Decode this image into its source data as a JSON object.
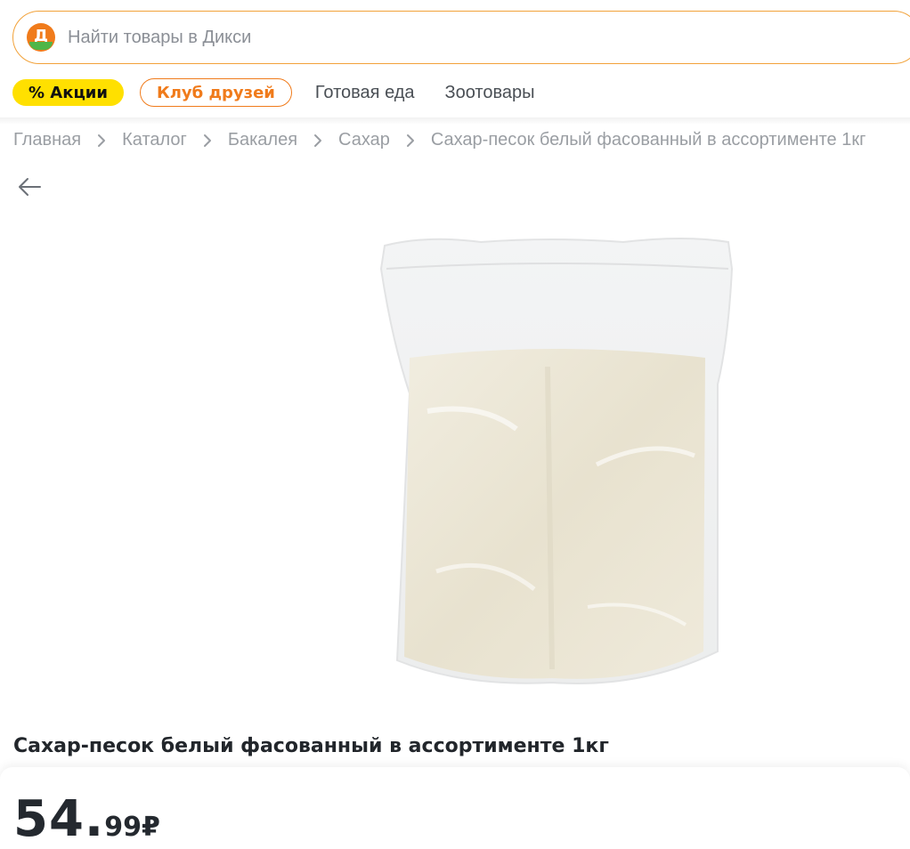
{
  "search": {
    "placeholder": "Найти товары в Дикси",
    "logo_letter": "Д"
  },
  "nav": {
    "sale_label": "% Акции",
    "club_label": "Клуб друзей",
    "links": [
      "Готовая еда",
      "Зоотовары"
    ]
  },
  "breadcrumb": [
    "Главная",
    "Каталог",
    "Бакалея",
    "Сахар",
    "Сахар-песок белый фасованный в ассортименте 1кг"
  ],
  "product": {
    "title": "Сахар-песок белый фасованный в ассортименте 1кг",
    "price_int": "54.",
    "price_frac": "99",
    "currency": "₽"
  },
  "colors": {
    "accent_orange": "#f07b1b",
    "sale_yellow": "#ffe000",
    "logo_green": "#4fb648"
  },
  "icons": {
    "logo": "dixy-logo-icon",
    "back": "arrow-left-icon",
    "separator": "chevron-right-icon"
  }
}
